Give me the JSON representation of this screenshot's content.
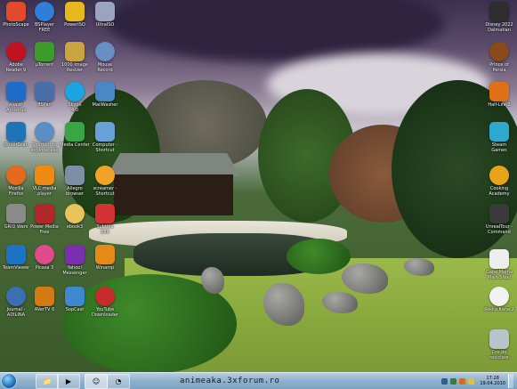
{
  "left_icons": [
    {
      "label": "PhotoScape",
      "icon": "photoscape-icon",
      "color": "#e24a2b"
    },
    {
      "label": "BSPlayer\nFREE",
      "icon": "bsplayer-icon",
      "color": "#2f7fd8"
    },
    {
      "label": "PowerISO",
      "icon": "poweriso-icon",
      "color": "#e7b81c"
    },
    {
      "label": "UltraISO",
      "icon": "ultraiso-icon",
      "color": "#9aa4c0"
    },
    {
      "label": "Adobe\nReader 9",
      "icon": "adobe-reader-icon",
      "color": "#c1121f"
    },
    {
      "label": "µTorrent",
      "icon": "utorrent-icon",
      "color": "#3d9b2c"
    },
    {
      "label": "1000 Image\nResizer",
      "icon": "image-resizer-icon",
      "color": "#c9a441"
    },
    {
      "label": "Mouse\nRecord",
      "icon": "mouse-record-icon",
      "color": "#6a8ec4"
    },
    {
      "label": "avast!\nAntivirus",
      "icon": "avast-icon",
      "color": "#1f6cc8"
    },
    {
      "label": "BSPad",
      "icon": "bspad-icon",
      "color": "#4a6ea8"
    },
    {
      "label": "Skype\n4.0",
      "icon": "skype-icon",
      "color": "#1aa4e0"
    },
    {
      "label": "MailWasher",
      "icon": "mailwasher-icon",
      "color": "#4b86c6"
    },
    {
      "label": "DriverScan",
      "icon": "driverscan-icon",
      "color": "#1e74b6"
    },
    {
      "label": "Shortcut to\nexplorer.exe",
      "icon": "explorer-shortcut-icon",
      "color": "#5b8ec4"
    },
    {
      "label": "Media Center",
      "icon": "media-center-icon",
      "color": "#3aa545"
    },
    {
      "label": "Computer -\nShortcut",
      "icon": "computer-shortcut-icon",
      "color": "#6aa0d8"
    },
    {
      "label": "Mozilla\nFirefox",
      "icon": "firefox-icon",
      "color": "#e66a1e"
    },
    {
      "label": "VLC media\nplayer",
      "icon": "vlc-icon",
      "color": "#ef8a14"
    },
    {
      "label": "Allegro\nbrowser",
      "icon": "allegro-icon",
      "color": "#7d8fa6"
    },
    {
      "label": "screamer -\nShortcut",
      "icon": "screamer-icon",
      "color": "#f1a228"
    },
    {
      "label": "GRID Wars",
      "icon": "grid-wars-icon",
      "color": "#8a8a8a"
    },
    {
      "label": "Power Media\nFree",
      "icon": "power-media-icon",
      "color": "#b0282a"
    },
    {
      "label": "ebook3",
      "icon": "ebook-folder-icon",
      "color": "#e9c45a"
    },
    {
      "label": "Subtitle\nEdit",
      "icon": "subtitle-edit-icon",
      "color": "#d23434"
    },
    {
      "label": "TeamViewer",
      "icon": "teamviewer-icon",
      "color": "#1f73c4"
    },
    {
      "label": "Picasa 3",
      "icon": "picasa-icon",
      "color": "#e04a8a"
    },
    {
      "label": "Yahoo!\nMessenger",
      "icon": "yahoo-messenger-icon",
      "color": "#7a2fb0"
    },
    {
      "label": "Winamp",
      "icon": "winamp-icon",
      "color": "#e48a18"
    },
    {
      "label": "Journal -\nADILINA",
      "icon": "journal-icon",
      "color": "#3c6fb0"
    },
    {
      "label": "AVerTV 6",
      "icon": "avertv-icon",
      "color": "#d47a12"
    },
    {
      "label": "SopCast",
      "icon": "sopcast-icon",
      "color": "#3e88d0"
    },
    {
      "label": "YouTube\nDownloader",
      "icon": "youtube-downloader-icon",
      "color": "#c72b2b"
    }
  ],
  "right_icons": [
    {
      "label": "Disney 2022\nDalmatian",
      "icon": "disney-icon",
      "color": "#2d2d2d"
    },
    {
      "label": "Prince of\nPersia",
      "icon": "prince-of-persia-icon",
      "color": "#8a4a1a"
    },
    {
      "label": "Half-Life 2",
      "icon": "half-life-icon",
      "color": "#e07018"
    },
    {
      "label": "Steam\nGames",
      "icon": "steam-icon",
      "color": "#2fa8d0"
    },
    {
      "label": "Cooking\nAcademy",
      "icon": "cooking-academy-icon",
      "color": "#e8a418"
    },
    {
      "label": "UnrealTour -\nCommand",
      "icon": "unreal-tournament-icon",
      "color": "#3a3a3a"
    },
    {
      "label": "Gabe Mama\nMain Steel",
      "icon": "ab-game-icon",
      "color": "#eeeeee"
    },
    {
      "label": "Pekka Kana 2",
      "icon": "pekka-kana-icon",
      "color": "#f2f2f2"
    },
    {
      "label": "Cos de\nreciclare",
      "icon": "recycle-bin-icon",
      "color": "#b8c4cc"
    }
  ],
  "taskbar": {
    "buttons": [
      {
        "name": "explorer-task-icon",
        "glyph": "📁",
        "active": false
      },
      {
        "name": "media-player-task-icon",
        "glyph": "▶",
        "active": false
      },
      {
        "name": "yahoo-task-icon",
        "glyph": "☺",
        "active": true
      },
      {
        "name": "network-task-icon",
        "glyph": "◔",
        "active": false
      }
    ],
    "clock_time": "17:28",
    "clock_date": "19.04.2010"
  },
  "watermark": "animeaka.3xforum.ro"
}
